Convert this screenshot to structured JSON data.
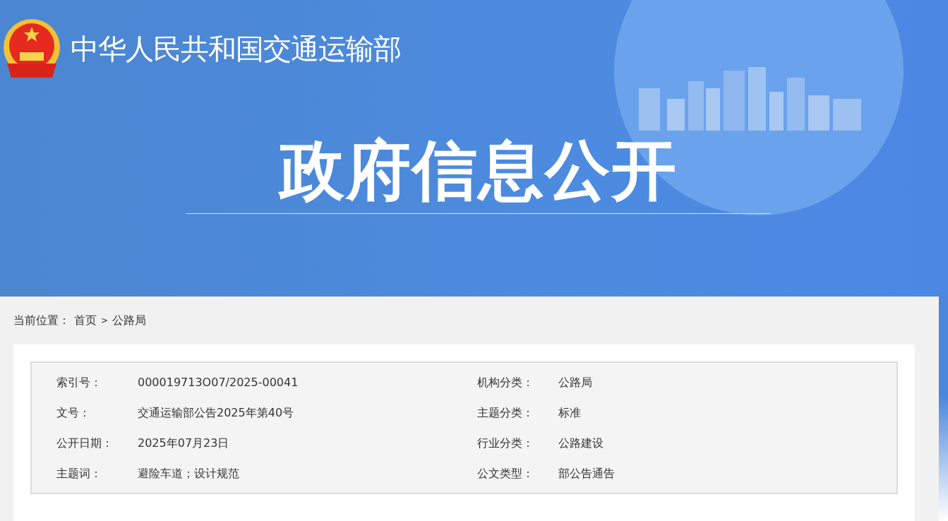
{
  "header": {
    "site_title": "中华人民共和国交通运输部",
    "banner_title": "政府信息公开"
  },
  "breadcrumb": {
    "label": "当前位置：",
    "items": [
      {
        "text": "首页",
        "kind": "link"
      },
      {
        "text": ">",
        "kind": "separator"
      },
      {
        "text": "公路局",
        "kind": "link"
      }
    ]
  },
  "info_table": {
    "rows": [
      [
        {
          "label": "索引号：",
          "value": "000019713O07/2025-00041"
        },
        {
          "label": "机构分类：",
          "value": "公路局"
        }
      ],
      [
        {
          "label": "文号：",
          "value": "交通运输部公告2025年第40号"
        },
        {
          "label": "主题分类：",
          "value": "标准"
        }
      ],
      [
        {
          "label": "公开日期：",
          "value": "2025年07月23日"
        },
        {
          "label": "行业分类：",
          "value": "公路建设"
        }
      ],
      [
        {
          "label": "主题词：",
          "value": "避险车道；设计规范"
        },
        {
          "label": "公文类型：",
          "value": "部公告通告"
        }
      ]
    ]
  }
}
